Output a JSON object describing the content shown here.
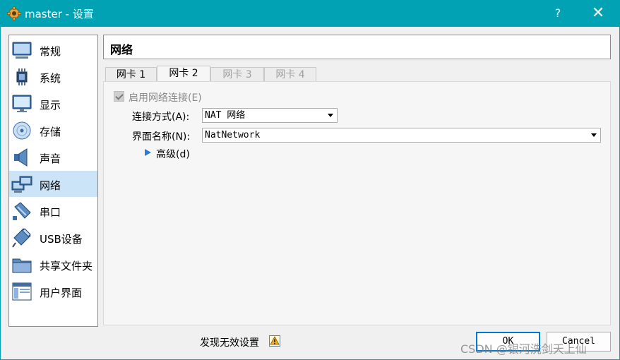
{
  "window": {
    "title": "master - 设置",
    "help_label": "?",
    "close_label": "✕",
    "app_icon": "gear-icon"
  },
  "sidebar": {
    "items": [
      {
        "label": "常规",
        "icon": "general-monitor-icon",
        "active": false
      },
      {
        "label": "系统",
        "icon": "system-chip-icon",
        "active": false
      },
      {
        "label": "显示",
        "icon": "display-icon",
        "active": false
      },
      {
        "label": "存储",
        "icon": "storage-disc-icon",
        "active": false
      },
      {
        "label": "声音",
        "icon": "speaker-icon",
        "active": false
      },
      {
        "label": "网络",
        "icon": "network-icon",
        "active": true
      },
      {
        "label": "串口",
        "icon": "serial-port-icon",
        "active": false
      },
      {
        "label": "USB设备",
        "icon": "usb-icon",
        "active": false
      },
      {
        "label": "共享文件夹",
        "icon": "shared-folder-icon",
        "active": false
      },
      {
        "label": "用户界面",
        "icon": "user-interface-icon",
        "active": false
      }
    ]
  },
  "header": {
    "title": "网络"
  },
  "tabs": [
    {
      "label": "网卡 1",
      "state": "normal"
    },
    {
      "label": "网卡 2",
      "state": "active"
    },
    {
      "label": "网卡 3",
      "state": "disabled"
    },
    {
      "label": "网卡 4",
      "state": "disabled"
    }
  ],
  "adapter": {
    "enable_label": "启用网络连接(E)",
    "enabled": true,
    "attached_label": "连接方式(A):",
    "attached_value": "NAT 网络",
    "name_label": "界面名称(N):",
    "name_value": "NatNetwork",
    "advanced_label": "高级(d)"
  },
  "footer": {
    "status_text": "发现无效设置",
    "ok_label": "OK",
    "cancel_label": "Cancel",
    "watermark": "CSDN @银河洗剑天上仙"
  },
  "colors": {
    "titlebar": "#00a2b4",
    "selection": "#cce4f7",
    "accent": "#0078d7"
  }
}
